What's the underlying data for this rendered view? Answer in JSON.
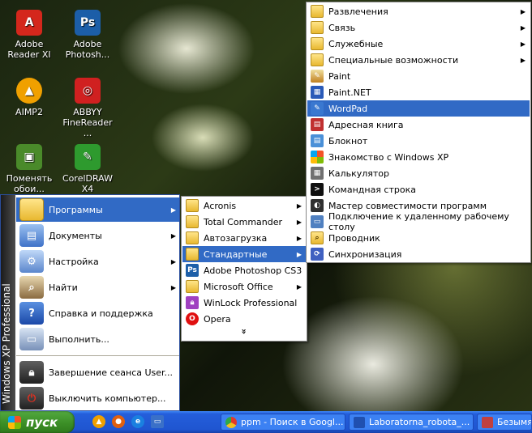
{
  "desktop": {
    "icons": [
      {
        "label": "Adobe Reader XI",
        "icon": "adobe-reader-icon",
        "color": "#d4271c"
      },
      {
        "label": "Adobe Photosh...",
        "icon": "photoshop-icon",
        "color": "#1c5ea8"
      },
      {
        "label": "AIMP2",
        "icon": "aimp-icon",
        "color": "#f0a000"
      },
      {
        "label": "ABBYY FineReader ...",
        "icon": "finereader-icon",
        "color": "#d02020"
      },
      {
        "label": "Поменять обои...",
        "icon": "wallpaper-icon",
        "color": "#4a8a2a"
      },
      {
        "label": "CorelDRAW X4",
        "icon": "coreldraw-icon",
        "color": "#2e9a2e"
      }
    ]
  },
  "start_menu": {
    "band_text": "Windows XP Professional",
    "items": [
      {
        "label": "Программы",
        "icon": "programs-folder-icon",
        "has_submenu": true
      },
      {
        "label": "Документы",
        "icon": "documents-icon",
        "has_submenu": true
      },
      {
        "label": "Настройка",
        "icon": "settings-icon",
        "has_submenu": true
      },
      {
        "label": "Найти",
        "icon": "search-icon",
        "has_submenu": true
      },
      {
        "label": "Справка и поддержка",
        "icon": "help-icon",
        "has_submenu": false
      },
      {
        "label": "Выполнить...",
        "icon": "run-icon",
        "has_submenu": false
      }
    ],
    "footer_items": [
      {
        "label": "Завершение сеанса User...",
        "icon": "logoff-lock-icon"
      },
      {
        "label": "Выключить компьютер...",
        "icon": "power-icon"
      }
    ]
  },
  "programs_menu": {
    "items": [
      {
        "label": "Acronis",
        "icon": "folder-icon",
        "has_submenu": true
      },
      {
        "label": "Total Commander",
        "icon": "folder-icon",
        "has_submenu": true
      },
      {
        "label": "Автозагрузка",
        "icon": "folder-icon",
        "has_submenu": true
      },
      {
        "label": "Стандартные",
        "icon": "folder-icon",
        "has_submenu": true
      },
      {
        "label": "Adobe Photoshop CS3",
        "icon": "photoshop-icon",
        "has_submenu": false
      },
      {
        "label": "Microsoft Office",
        "icon": "folder-icon",
        "has_submenu": true
      },
      {
        "label": "WinLock Professional",
        "icon": "winlock-icon",
        "has_submenu": false
      },
      {
        "label": "Opera",
        "icon": "opera-icon",
        "has_submenu": false
      }
    ],
    "expand_glyph": "»"
  },
  "accessories_menu": {
    "items": [
      {
        "label": "Развлечения",
        "icon": "folder-icon",
        "has_submenu": true
      },
      {
        "label": "Связь",
        "icon": "folder-icon",
        "has_submenu": true
      },
      {
        "label": "Служебные",
        "icon": "folder-icon",
        "has_submenu": true
      },
      {
        "label": "Специальные возможности",
        "icon": "folder-icon",
        "has_submenu": true
      },
      {
        "label": "Paint",
        "icon": "paint-icon",
        "has_submenu": false
      },
      {
        "label": "Paint.NET",
        "icon": "paintnet-icon",
        "has_submenu": false
      },
      {
        "label": "WordPad",
        "icon": "wordpad-icon",
        "has_submenu": false
      },
      {
        "label": "Адресная книга",
        "icon": "address-book-icon",
        "has_submenu": false
      },
      {
        "label": "Блокнот",
        "icon": "notepad-icon",
        "has_submenu": false
      },
      {
        "label": "Знакомство с Windows XP",
        "icon": "tour-icon",
        "has_submenu": false
      },
      {
        "label": "Калькулятор",
        "icon": "calculator-icon",
        "has_submenu": false
      },
      {
        "label": "Командная строка",
        "icon": "command-prompt-icon",
        "has_submenu": false
      },
      {
        "label": "Мастер совместимости программ",
        "icon": "compatibility-wizard-icon",
        "has_submenu": false
      },
      {
        "label": "Подключение к удаленному рабочему столу",
        "icon": "remote-desktop-icon",
        "has_submenu": false
      },
      {
        "label": "Проводник",
        "icon": "explorer-icon",
        "has_submenu": false
      },
      {
        "label": "Синхронизация",
        "icon": "sync-icon",
        "has_submenu": false
      }
    ]
  },
  "taskbar": {
    "start_label": "пуск",
    "quick_launch": [
      {
        "icon": "aimp-quick-icon",
        "color": "#f0a000"
      },
      {
        "icon": "firefox-quick-icon",
        "color": "#e06010"
      },
      {
        "icon": "ie-quick-icon",
        "color": "#1a80e0"
      },
      {
        "icon": "show-desktop-icon",
        "color": "#3a70c8"
      }
    ],
    "tasks": [
      {
        "label": "ppm - Поиск в Googl...",
        "icon": "chrome-icon",
        "color": "#e8b020"
      },
      {
        "label": "Laboratorna_robota_...",
        "icon": "word-document-icon",
        "color": "#2050b0"
      },
      {
        "label": "Безымя",
        "icon": "paint-task-icon",
        "color": "#c04040"
      }
    ]
  },
  "colors": {
    "selection": "#316ac5",
    "taskbar": "#245edb",
    "start_button": "#3a8d25"
  }
}
